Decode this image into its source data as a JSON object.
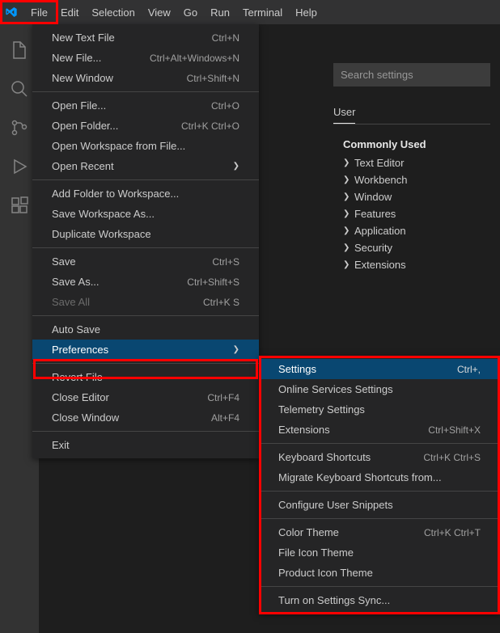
{
  "menubar": {
    "items": [
      "File",
      "Edit",
      "Selection",
      "View",
      "Go",
      "Run",
      "Terminal",
      "Help"
    ]
  },
  "file_menu": {
    "groups": [
      [
        {
          "label": "New Text File",
          "shortcut": "Ctrl+N"
        },
        {
          "label": "New File...",
          "shortcut": "Ctrl+Alt+Windows+N"
        },
        {
          "label": "New Window",
          "shortcut": "Ctrl+Shift+N"
        }
      ],
      [
        {
          "label": "Open File...",
          "shortcut": "Ctrl+O"
        },
        {
          "label": "Open Folder...",
          "shortcut": "Ctrl+K Ctrl+O"
        },
        {
          "label": "Open Workspace from File..."
        },
        {
          "label": "Open Recent",
          "submenu": true
        }
      ],
      [
        {
          "label": "Add Folder to Workspace..."
        },
        {
          "label": "Save Workspace As..."
        },
        {
          "label": "Duplicate Workspace"
        }
      ],
      [
        {
          "label": "Save",
          "shortcut": "Ctrl+S"
        },
        {
          "label": "Save As...",
          "shortcut": "Ctrl+Shift+S"
        },
        {
          "label": "Save All",
          "shortcut": "Ctrl+K S",
          "disabled": true
        }
      ],
      [
        {
          "label": "Auto Save"
        },
        {
          "label": "Preferences",
          "submenu": true,
          "highlighted": true
        }
      ],
      [
        {
          "label": "Revert File"
        },
        {
          "label": "Close Editor",
          "shortcut": "Ctrl+F4"
        },
        {
          "label": "Close Window",
          "shortcut": "Alt+F4"
        }
      ],
      [
        {
          "label": "Exit"
        }
      ]
    ]
  },
  "preferences_submenu": {
    "groups": [
      [
        {
          "label": "Settings",
          "shortcut": "Ctrl+,",
          "highlighted": true
        },
        {
          "label": "Online Services Settings"
        },
        {
          "label": "Telemetry Settings"
        },
        {
          "label": "Extensions",
          "shortcut": "Ctrl+Shift+X"
        }
      ],
      [
        {
          "label": "Keyboard Shortcuts",
          "shortcut": "Ctrl+K Ctrl+S"
        },
        {
          "label": "Migrate Keyboard Shortcuts from..."
        }
      ],
      [
        {
          "label": "Configure User Snippets"
        }
      ],
      [
        {
          "label": "Color Theme",
          "shortcut": "Ctrl+K Ctrl+T"
        },
        {
          "label": "File Icon Theme"
        },
        {
          "label": "Product Icon Theme"
        }
      ],
      [
        {
          "label": "Turn on Settings Sync..."
        }
      ]
    ]
  },
  "settings": {
    "search_placeholder": "Search settings",
    "tab_user": "User",
    "tree_heading": "Commonly Used",
    "tree_items": [
      "Text Editor",
      "Workbench",
      "Window",
      "Features",
      "Application",
      "Security",
      "Extensions"
    ]
  }
}
